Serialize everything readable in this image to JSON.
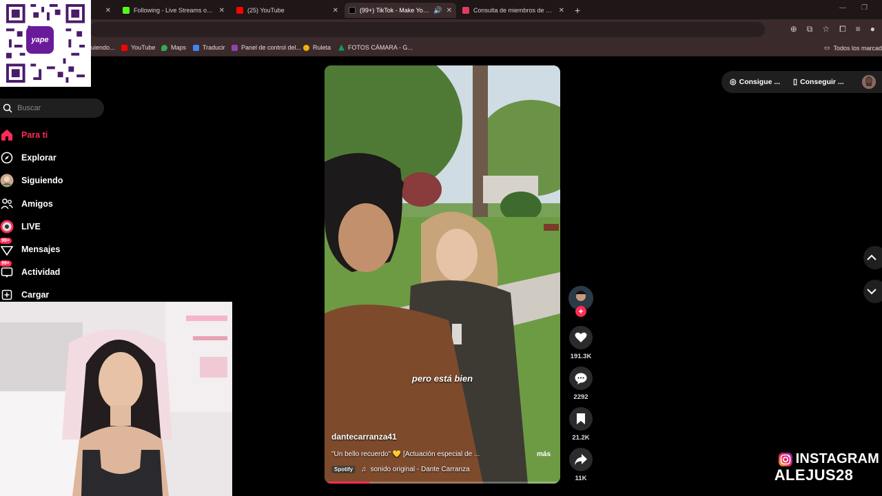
{
  "browser": {
    "tabs": [
      {
        "title": "",
        "favicon_color": "#9aa0a6",
        "active": false
      },
      {
        "title": "Following - Live Streams on Ki",
        "favicon_color": "#53fc18",
        "active": false
      },
      {
        "title": "(25) YouTube",
        "favicon_color": "#ff0000",
        "active": false
      },
      {
        "title": "(99+) TikTok - Make Your Da",
        "favicon_color": "#000000",
        "active": true
      },
      {
        "title": "Consulta de miembros de mesa",
        "favicon_color": "#e33b5f",
        "active": false
      }
    ],
    "new_tab": "+",
    "bookmarks": [
      {
        "label": "uiendo...",
        "color": "#fe2c55"
      },
      {
        "label": "YouTube",
        "color": "#ff0000"
      },
      {
        "label": "Maps",
        "color": "#34a853"
      },
      {
        "label": "Traducir",
        "color": "#4285f4"
      },
      {
        "label": "Panel de control del...",
        "color": "#8e44ad"
      },
      {
        "label": "Ruleta",
        "color": "#f4b400"
      },
      {
        "label": "FOTOS CÁMARA - G...",
        "color": "#0f9d58"
      }
    ],
    "all_bookmarks": "Todos los marcado"
  },
  "sidebar": {
    "search_placeholder": "Buscar",
    "items": [
      {
        "label": "Para ti",
        "icon": "home-icon",
        "active": true
      },
      {
        "label": "Explorar",
        "icon": "compass-icon",
        "active": false
      },
      {
        "label": "Siguiendo",
        "icon": "following-avatar-icon",
        "active": false
      },
      {
        "label": "Amigos",
        "icon": "friends-icon",
        "active": false
      },
      {
        "label": "LIVE",
        "icon": "live-icon",
        "active": false
      },
      {
        "label": "Mensajes",
        "icon": "messages-icon",
        "active": false,
        "badge": "99+"
      },
      {
        "label": "Actividad",
        "icon": "activity-icon",
        "active": false,
        "badge": "99+"
      },
      {
        "label": "Cargar",
        "icon": "upload-icon",
        "active": false
      }
    ]
  },
  "qr": {
    "logo_text": "yape"
  },
  "video": {
    "caption": "pero está bien",
    "author": "dantecarranza41",
    "description": "\"Un bello recuerdo\" 💛 [Actuación especial de ...",
    "more": "más",
    "music_tag": "Spotify",
    "music": "sonido original - Dante Carranza",
    "progress": 0.19
  },
  "actions": {
    "likes": "191.3K",
    "comments": "2292",
    "saves": "21.2K",
    "shares": "11K"
  },
  "top_right": {
    "coins_label": "Consigue ...",
    "app_label": "Conseguir ..."
  },
  "overlay": {
    "instagram_label": "INSTAGRAM",
    "handle": "ALEJUS28"
  },
  "colors": {
    "accent": "#fe2c55",
    "chrome_bg": "#3a2a2c"
  }
}
